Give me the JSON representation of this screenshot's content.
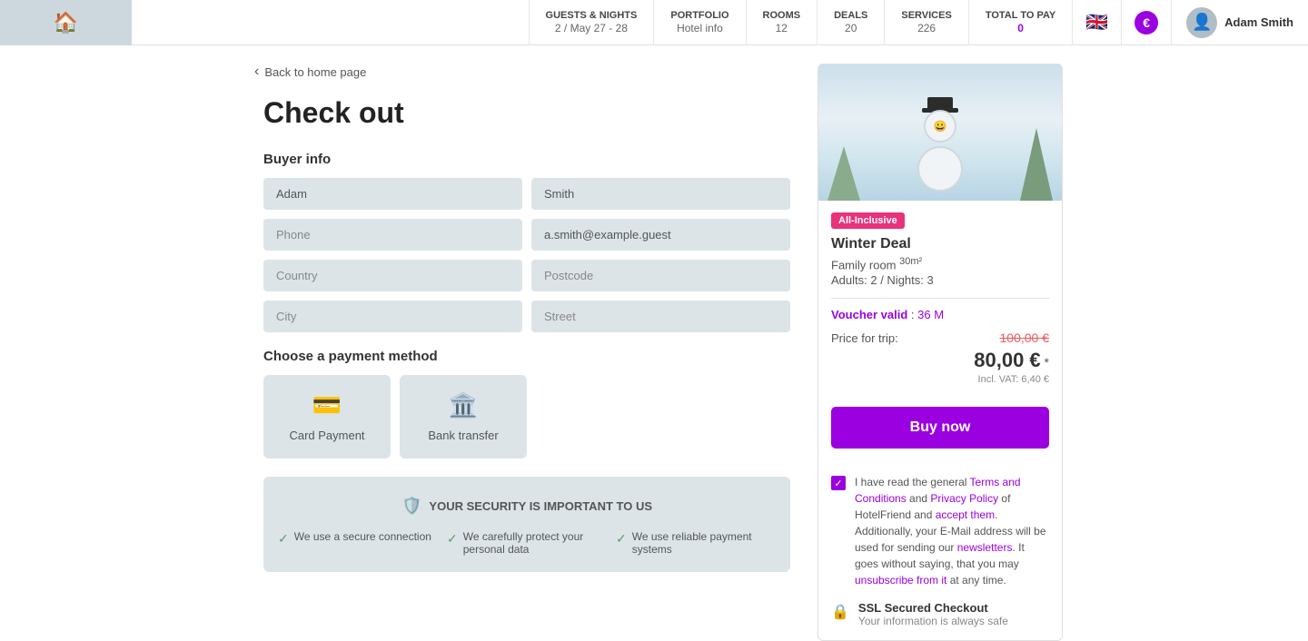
{
  "nav": {
    "guests_nights_label": "GUESTS & NIGHTS",
    "guests_nights_value": "2 / May 27 - 28",
    "portfolio_label": "PORTFOLIO",
    "portfolio_value": "Hotel info",
    "rooms_label": "ROOMS",
    "rooms_value": "12",
    "deals_label": "DEALS",
    "deals_value": "20",
    "services_label": "SERVICES",
    "services_value": "226",
    "total_label": "TOTAL TO PAY",
    "total_value": "0",
    "user_name": "Adam Smith"
  },
  "back_link": "Back to home page",
  "page_title": "Check out",
  "buyer_info": {
    "section_label": "Buyer info",
    "first_name": "Adam",
    "last_name": "Smith",
    "phone_placeholder": "Phone",
    "email": "a.smith@example.guest",
    "country_placeholder": "Country",
    "postcode_placeholder": "Postcode",
    "city_placeholder": "City",
    "street_placeholder": "Street"
  },
  "payment": {
    "section_label": "Choose a payment method",
    "card_label": "Card Payment",
    "bank_label": "Bank transfer"
  },
  "security": {
    "title": "YOUR SECURITY IS IMPORTANT TO US",
    "point1": "We use a secure connection",
    "point2": "We carefully protect your personal data",
    "point3": "We use reliable payment systems"
  },
  "hotel_card": {
    "badge": "All-Inclusive",
    "deal_title": "Winter Deal",
    "room_type": "Family room",
    "room_size": "30m²",
    "guests_label": "Adults: 2 / Nights: 3",
    "voucher_label": "Voucher valid",
    "voucher_colon": " : ",
    "voucher_duration": "36 M",
    "price_for_trip_label": "Price for trip:",
    "old_price": "100,00 €",
    "new_price": "80,00 €",
    "asterisk": "*",
    "vat_text": "Incl. VAT: 6,40 €",
    "buy_now": "Buy now"
  },
  "terms": {
    "text_part1": "I have read the general ",
    "terms_link": "Terms and Conditions",
    "text_part2": " and ",
    "privacy_link": "Privacy Policy",
    "text_part3": " of HotelFriend and ",
    "accept_link": "accept them",
    "text_part4": ". Additionally, your E-Mail address will be used for sending our ",
    "newsletter_link": "newsletters",
    "text_part5": ". It goes without saying, that you may ",
    "unsubscribe_link": "unsubscribe from it",
    "text_part6": " at any time."
  },
  "ssl": {
    "title": "SSL Secured Checkout",
    "subtitle": "Your information is always safe"
  }
}
